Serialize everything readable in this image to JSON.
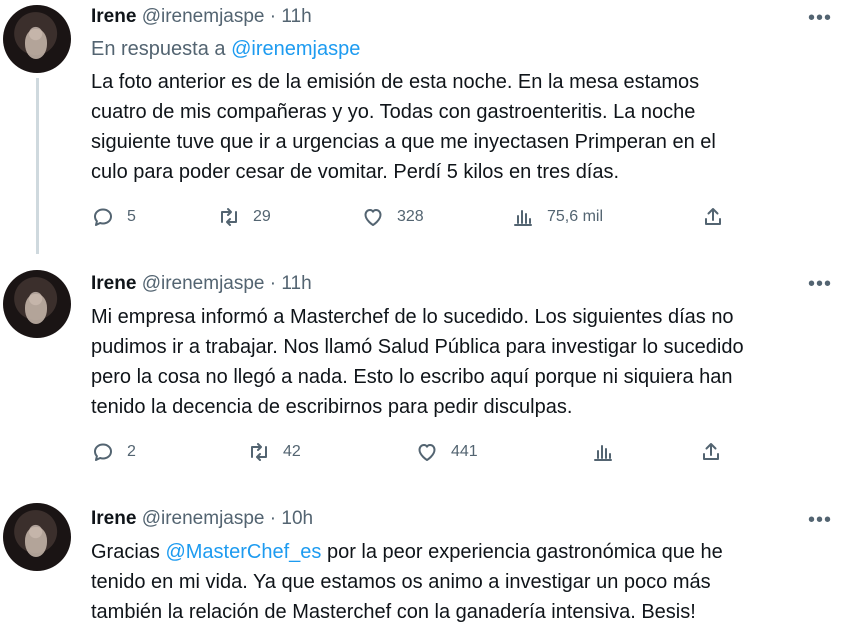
{
  "tweets": [
    {
      "name": "Irene",
      "handle": "@irenemjaspe",
      "separator": "·",
      "time": "11h",
      "reply_label": "En respuesta a",
      "reply_handle": "@irenemjaspe",
      "lines": [
        "La foto anterior es de la emisión de esta noche. En la mesa estamos",
        "cuatro de mis compañeras y yo. Todas con gastroenteritis. La noche",
        "siguiente tuve que ir a urgencias a que me inyectasen Primperan en el",
        "culo para poder cesar de vomitar. Perdí 5 kilos en tres días."
      ],
      "replies": "5",
      "retweets": "29",
      "likes": "328",
      "views": "75,6 mil"
    },
    {
      "name": "Irene",
      "handle": "@irenemjaspe",
      "separator": "·",
      "time": "11h",
      "lines": [
        "Mi empresa informó a Masterchef de lo sucedido. Los siguientes días no",
        "pudimos ir a trabajar. Nos llamó Salud Pública para investigar lo sucedido",
        "pero la cosa no llegó a nada. Esto lo escribo aquí porque ni siquiera han",
        "tenido la decencia de escribirnos para pedir disculpas."
      ],
      "replies": "2",
      "retweets": "42",
      "likes": "441",
      "views": ""
    },
    {
      "name": "Irene",
      "handle": "@irenemjaspe",
      "separator": "·",
      "time": "10h",
      "line1_before": "Gracias ",
      "line1_mention": "@MasterChef_es",
      "line1_after": " por la peor experiencia gastronómica que he",
      "lines": [
        "tenido en mi vida. Ya que estamos os animo a investigar un poco más",
        "también la relación de Masterchef con la ganadería intensiva. Besis!"
      ]
    }
  ],
  "icons": {
    "more": "more-icon",
    "reply": "reply-icon",
    "retweet": "retweet-icon",
    "like": "like-icon",
    "views": "views-icon",
    "share": "share-icon"
  },
  "colors": {
    "text": "#0f1419",
    "secondary": "#536471",
    "link": "#1d9bf0",
    "thread_line": "#cfd9de"
  }
}
